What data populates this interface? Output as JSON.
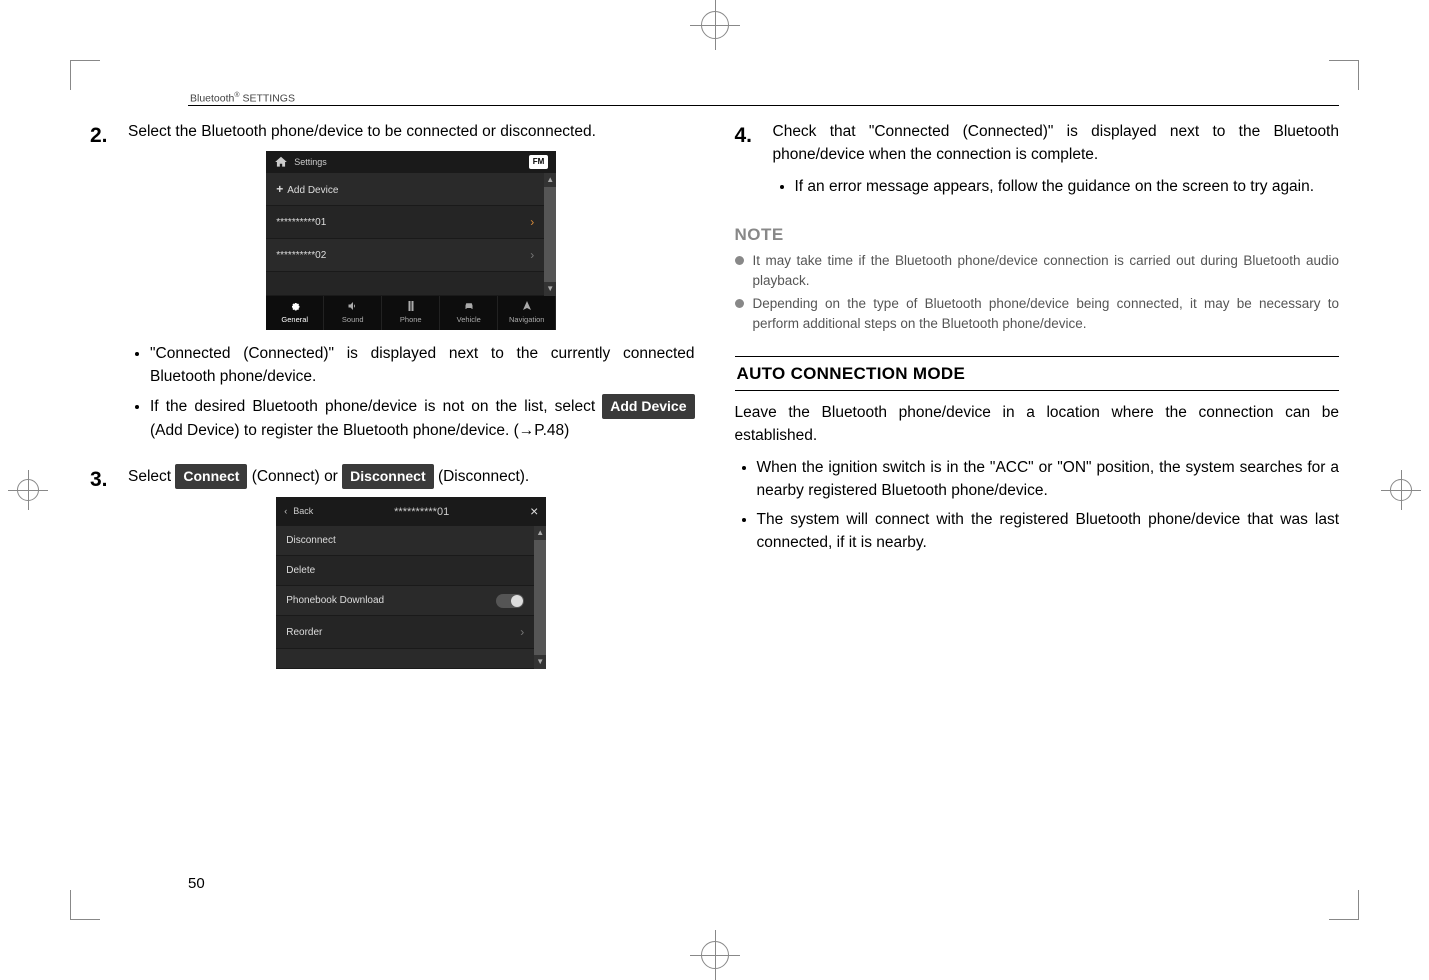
{
  "header": "Bluetooth® SETTINGS",
  "pageNumber": "50",
  "left": {
    "step2": {
      "num": "2.",
      "text1": "Select the Bluetooth phone/device to be connected or disconnected.",
      "bullet1": "\"Connected (Connected)\" is displayed next to the currently connected Bluetooth phone/device.",
      "bullet2a": "If the desired Bluetooth phone/device is not on the list, select ",
      "bullet2_pill": "Add Device",
      "bullet2b": " (Add Device) to register the Bluetooth phone/device. (→P.48)"
    },
    "step3": {
      "num": "3.",
      "text_a": "Select ",
      "pill_connect": "Connect",
      "text_b": " (Connect) or ",
      "pill_disconnect": "Disconnect",
      "text_c": " (Disconnect)."
    },
    "ss1": {
      "title": "Settings",
      "fm": "FM",
      "addDevice": "Add Device",
      "dev1": "**********01",
      "dev2": "**********02",
      "tabs": {
        "general": "General",
        "sound": "Sound",
        "phone": "Phone",
        "vehicle": "Vehicle",
        "nav": "Navigation"
      }
    },
    "ss2": {
      "back": "Back",
      "title": "**********01",
      "disconnect": "Disconnect",
      "delete": "Delete",
      "phonebook": "Phonebook Download",
      "reorder": "Reorder"
    }
  },
  "right": {
    "step4": {
      "num": "4.",
      "text1": "Check that \"Connected (Connected)\" is displayed next to the Bluetooth phone/device when the connection is complete.",
      "bullet1": "If an error message appears, follow the guidance on the screen to try again."
    },
    "note": {
      "head": "NOTE",
      "n1": "It may take time if the Bluetooth phone/device connection is carried out during Bluetooth audio playback.",
      "n2": "Depending on the type of Bluetooth phone/device being connected, it may be necessary to perform additional steps on the Bluetooth phone/device."
    },
    "subhead": "AUTO CONNECTION MODE",
    "para": "Leave the Bluetooth phone/device in a location where the connection can be established.",
    "b1": "When the ignition switch is in the \"ACC\" or \"ON\" position, the system searches for a nearby registered Bluetooth phone/device.",
    "b2": "The system will connect with the registered Bluetooth phone/device that was last connected, if it is nearby."
  }
}
